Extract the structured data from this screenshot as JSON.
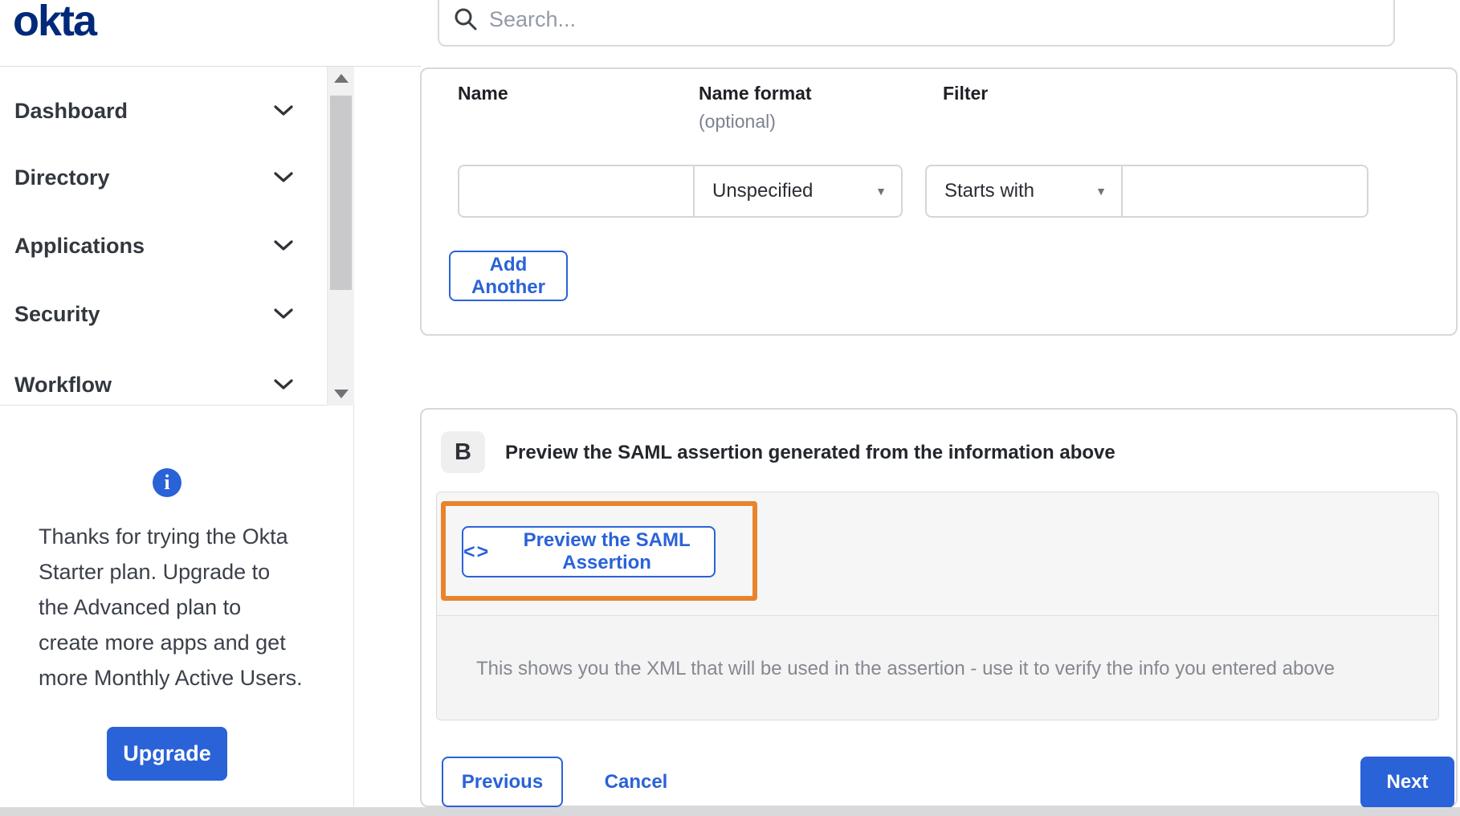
{
  "brand": {
    "logo_text": "okta"
  },
  "header": {
    "search": {
      "placeholder": "Search...",
      "icon": "magnifier"
    }
  },
  "sidebar": {
    "nav_items": [
      {
        "label": "Dashboard"
      },
      {
        "label": "Directory"
      },
      {
        "label": "Applications"
      },
      {
        "label": "Security"
      },
      {
        "label": "Workflow"
      }
    ],
    "plan_notice": {
      "lines": [
        "Thanks for trying the Okta",
        "Starter plan. Upgrade to",
        "the Advanced plan to",
        "create more apps and get",
        "more Monthly Active Users."
      ],
      "upgrade_label": "Upgrade"
    }
  },
  "main": {
    "attribute_form": {
      "name_label": "Name",
      "name_format_label": "Name format",
      "name_format_optional": "(optional)",
      "filter_label": "Filter",
      "name_value": "",
      "name_format_value": "Unspecified",
      "filter_type_value": "Starts with",
      "filter_value": "",
      "add_another_label": "Add Another"
    },
    "preview_section": {
      "badge": "B",
      "title": "Preview the SAML assertion generated from the information above",
      "preview_button_label": "Preview the SAML Assertion",
      "description": "This shows you the XML that will be used in the assertion - use it to verify the info you entered above"
    },
    "footer": {
      "previous_label": "Previous",
      "cancel_label": "Cancel",
      "next_label": "Next"
    }
  },
  "icons": {
    "info_glyph": "i",
    "code_glyph": "<>",
    "dropdown_arrow": "▼"
  },
  "colors": {
    "accent_blue": "#2a62d8",
    "logo_navy": "#00297a",
    "annotation_orange": "#e8842d"
  }
}
